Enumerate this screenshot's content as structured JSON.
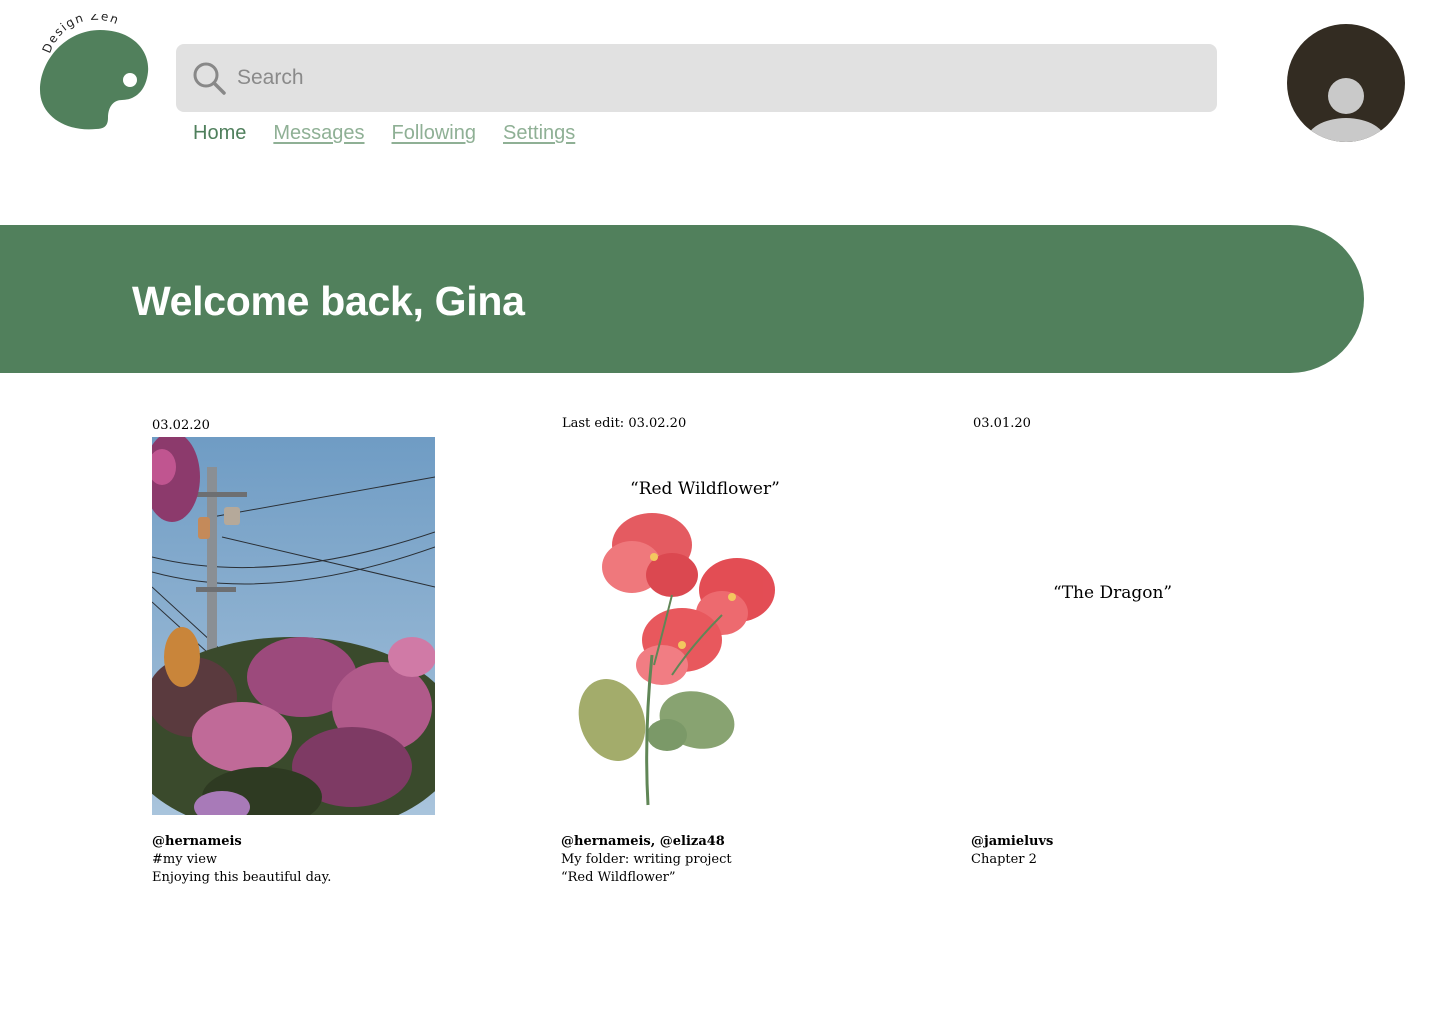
{
  "brand": {
    "logo_text": "Design Zen"
  },
  "search": {
    "placeholder": "Search"
  },
  "nav": {
    "home": "Home",
    "messages": "Messages",
    "following": "Following",
    "settings": "Settings"
  },
  "banner": {
    "greeting": "Welcome back, Gina"
  },
  "posts": [
    {
      "date": "03.02.20",
      "user": "@hernameis",
      "line1": "#my view",
      "line2": "Enjoying this beautiful day."
    },
    {
      "date": "Last edit: 03.02.20",
      "title": "“Red Wildflower”",
      "user": "@hernameis, @eliza48",
      "line1": "My folder: writing project",
      "line2": "“Red Wildflower”"
    },
    {
      "date": "03.01.20",
      "title": "“The Dragon”",
      "user": "@jamieluvs",
      "line1": "Chapter 2"
    }
  ],
  "colors": {
    "brand_green": "#51805c",
    "nav_link": "#8fb095",
    "search_bg": "#e1e1e1",
    "avatar_bg": "#332c22"
  }
}
